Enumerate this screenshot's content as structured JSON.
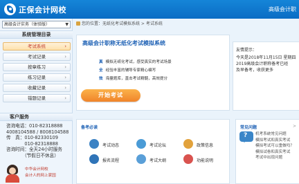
{
  "header": {
    "site_name": "正保会计网校",
    "right_text": "高级会计职"
  },
  "sidebar": {
    "course_select": "高级会计实务（体验版）",
    "menu_title": "系统管理目录",
    "items": [
      {
        "label": "考试系统"
      },
      {
        "label": "考试记录"
      },
      {
        "label": "按章练习"
      },
      {
        "label": "练习记录"
      },
      {
        "label": "收藏记录"
      },
      {
        "label": "错题记录"
      }
    ],
    "service_title": "客户服务",
    "service_lines": [
      "咨询电话：010-82318888",
      "4008104588 / 8008104588",
      "传　真：010-82330109",
      "　　　　010-82318888",
      "咨询时间：全天24小时服务",
      "　　　　（节假日不休息）"
    ],
    "slogan_1": "中华会计网校",
    "slogan_2": "会计人的网上家园"
  },
  "breadcrumb": {
    "text": "您的位置：无纸化考试模拟系统 > 考试系统"
  },
  "intro": {
    "title": "高级会计职称无纸化考试模拟系统",
    "features": [
      {
        "key": "真",
        "text": "模拟无纸化考试，感受真实的考试场景"
      },
      {
        "key": "全",
        "text": "经验丰富的辅导专家精心编写"
      },
      {
        "key": "效",
        "text": "海量题库，直击考试精髓，高效提分"
      }
    ],
    "start_button": "开始考试"
  },
  "tips": {
    "title": "友情提示：",
    "body": "今天是2018年11月15日 星期四\n2019高级会计职称备考已经\n及早备考，收获更多"
  },
  "guide": {
    "title": "备考必读",
    "items": [
      {
        "label": "考试动态",
        "icon": "news-icon",
        "color": "#3b82c4"
      },
      {
        "label": "考试论坛",
        "icon": "forum-icon",
        "color": "#4a9bd6"
      },
      {
        "label": "政策信息",
        "icon": "policy-icon",
        "color": "#e2a23c"
      },
      {
        "label": "报名流程",
        "icon": "register-icon",
        "color": "#2f74b8"
      },
      {
        "label": "考试大纲",
        "icon": "outline-icon",
        "color": "#5a9fd8"
      },
      {
        "label": "功能说明",
        "icon": "help-icon",
        "color": "#d9534f"
      }
    ]
  },
  "faq": {
    "title": "常见问题",
    "more": ">",
    "items": [
      "机考系统常见问题",
      "模拟考试和真实考试",
      "模拟考试可以重做吗？",
      "模拟试卷和真实考试",
      "考试中出现问题"
    ]
  }
}
